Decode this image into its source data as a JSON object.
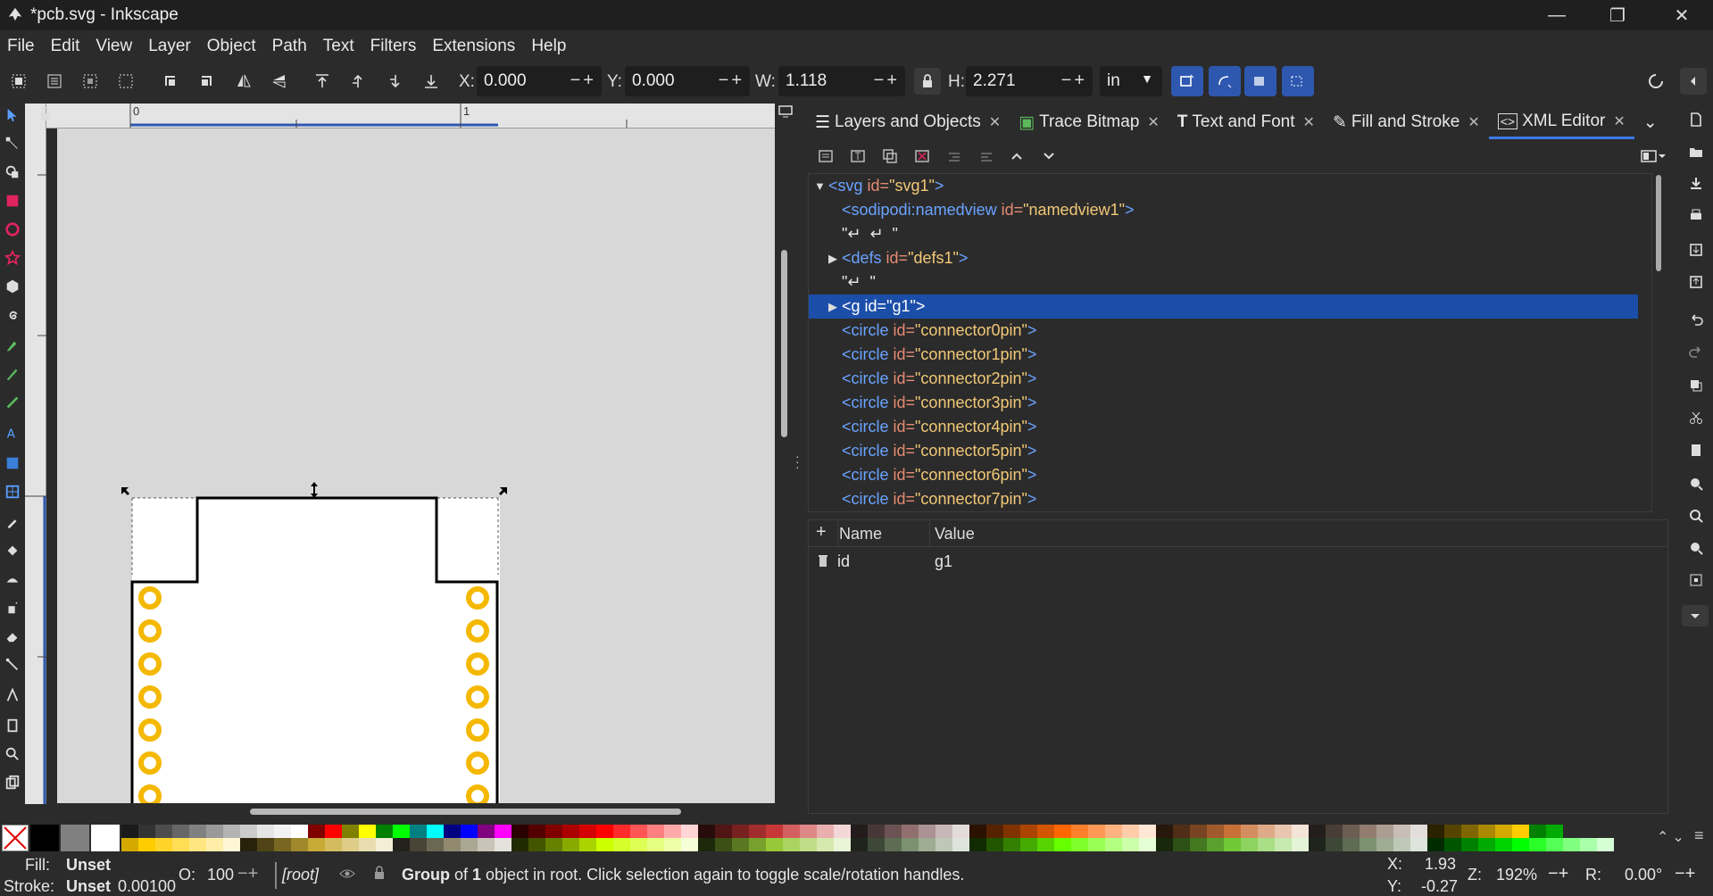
{
  "window": {
    "title": "*pcb.svg - Inkscape",
    "minimize": "—",
    "maximize": "❐",
    "close": "✕"
  },
  "menu": [
    "File",
    "Edit",
    "View",
    "Layer",
    "Object",
    "Path",
    "Text",
    "Filters",
    "Extensions",
    "Help"
  ],
  "toolbar": {
    "x_label": "X:",
    "x_value": "0.000",
    "y_label": "Y:",
    "y_value": "0.000",
    "w_label": "W:",
    "w_value": "1.118",
    "h_label": "H:",
    "h_value": "2.271",
    "unit": "in",
    "spin_buttons": "−+"
  },
  "ruler": {
    "mark0": "0",
    "mark1": "1"
  },
  "tabs": [
    {
      "icon": "layers-icon",
      "label": "Layers and Objects"
    },
    {
      "icon": "trace-bitmap-icon",
      "label": "Trace Bitmap"
    },
    {
      "icon": "text-font-icon",
      "label": "Text and Font"
    },
    {
      "icon": "fill-stroke-icon",
      "label": "Fill and Stroke"
    },
    {
      "icon": "xml-editor-icon",
      "label": "XML Editor"
    }
  ],
  "xml_nodes": [
    {
      "tag": "<svg",
      "attr": " id=",
      "val": "\"svg1\"",
      "close": ">",
      "expander": "▼"
    },
    {
      "tag": "<sodipodi:namedview",
      "attr": " id=",
      "val": "\"namedview1\"",
      "close": ">"
    },
    {
      "text": "\"↵  ↵  \""
    },
    {
      "tag": "<defs",
      "attr": " id=",
      "val": "\"defs1\"",
      "close": ">",
      "expander": "▶"
    },
    {
      "text": "\"↵  \""
    },
    {
      "tag": "<g",
      "attr": " id=",
      "val": "\"g1\"",
      "close": ">",
      "expander": "▶",
      "selected": true
    },
    {
      "tag": "<circle",
      "attr": " id=",
      "val": "\"connector0pin\"",
      "close": ">"
    },
    {
      "tag": "<circle",
      "attr": " id=",
      "val": "\"connector1pin\"",
      "close": ">"
    },
    {
      "tag": "<circle",
      "attr": " id=",
      "val": "\"connector2pin\"",
      "close": ">"
    },
    {
      "tag": "<circle",
      "attr": " id=",
      "val": "\"connector3pin\"",
      "close": ">"
    },
    {
      "tag": "<circle",
      "attr": " id=",
      "val": "\"connector4pin\"",
      "close": ">"
    },
    {
      "tag": "<circle",
      "attr": " id=",
      "val": "\"connector5pin\"",
      "close": ">"
    },
    {
      "tag": "<circle",
      "attr": " id=",
      "val": "\"connector6pin\"",
      "close": ">"
    },
    {
      "tag": "<circle",
      "attr": " id=",
      "val": "\"connector7pin\"",
      "close": ">"
    }
  ],
  "attributes": {
    "add_label": "+",
    "name_header": "Name",
    "value_header": "Value",
    "rows": [
      {
        "name": "id",
        "value": "g1"
      }
    ]
  },
  "palette": {
    "row1": [
      "#000000",
      "#808080",
      "#ffffff",
      "#1a1a1a",
      "#333333",
      "#4d4d4d",
      "#666666",
      "#808080",
      "#999999",
      "#b3b3b3",
      "#cccccc",
      "#e6e6e6",
      "#f2f2f2",
      "#ffffff",
      "#800000",
      "#ff0000",
      "#808000",
      "#ffff00",
      "#008000",
      "#00ff00",
      "#008080",
      "#00ffff",
      "#000080",
      "#0000ff",
      "#800080",
      "#ff00ff",
      "#2b0000",
      "#550000",
      "#800000",
      "#aa0000",
      "#d40000",
      "#ff0000",
      "#ff2a2a",
      "#ff5555",
      "#ff8080",
      "#ffaaaa",
      "#ffd5d5",
      "#280b0b",
      "#501616",
      "#782121",
      "#a02c2c",
      "#c83737",
      "#d35f5f",
      "#de8787",
      "#e9afaf",
      "#f4d7d7",
      "#241c1c",
      "#483737",
      "#6c5353",
      "#916f6f",
      "#ac9393",
      "#c8b7b7",
      "#e3dbdb",
      "#2b1100",
      "#552200",
      "#803300",
      "#aa4400",
      "#d45500",
      "#ff6600",
      "#ff7f2a",
      "#ff9955",
      "#ffb380",
      "#ffccaa",
      "#ffe6d5",
      "#28170b",
      "#502d16",
      "#784421",
      "#a05a2c",
      "#c87137",
      "#d38d5f",
      "#deaa87",
      "#e9c6af",
      "#f4e3d7",
      "#241f1c",
      "#483e37",
      "#6c5d53",
      "#917c6f",
      "#ac9d93",
      "#c8beb7",
      "#e3dedb",
      "#2b2200",
      "#554400",
      "#806600",
      "#aa8800",
      "#d4aa00",
      "#ffcc00",
      "#008000",
      "#00aa00"
    ],
    "row2": [
      "#d4aa00",
      "#ffcc00",
      "#ffd42a",
      "#ffdd55",
      "#ffe680",
      "#ffeeaa",
      "#fff6d5",
      "#28220b",
      "#504416",
      "#786721",
      "#a0892c",
      "#c8ab37",
      "#d3bc5f",
      "#decd87",
      "#e9ddaf",
      "#f4eed7",
      "#24221c",
      "#484537",
      "#6c6753",
      "#918a6f",
      "#aca793",
      "#c8c4b7",
      "#e3e2db",
      "#222b00",
      "#445500",
      "#668000",
      "#88aa00",
      "#aad400",
      "#ccff00",
      "#d4ff2a",
      "#ddff55",
      "#e5ff80",
      "#eeffaa",
      "#f6ffd5",
      "#1e280b",
      "#3c5016",
      "#5a7821",
      "#78a02c",
      "#96c837",
      "#abd35f",
      "#c0de87",
      "#d5e9af",
      "#eaf4d7",
      "#1f241c",
      "#3e4837",
      "#5d6c53",
      "#7c916f",
      "#9dac93",
      "#bec8b7",
      "#dee3db",
      "#112b00",
      "#225500",
      "#338000",
      "#44aa00",
      "#55d400",
      "#66ff00",
      "#7fff2a",
      "#99ff55",
      "#b3ff80",
      "#ccffaa",
      "#e5ffd5",
      "#17280b",
      "#2d5016",
      "#447821",
      "#5aa02c",
      "#71c837",
      "#8dd35f",
      "#aade87",
      "#c6e9af",
      "#e3f4d7",
      "#1f241c",
      "#3e4837",
      "#5d6c53",
      "#7c916f",
      "#9dac93",
      "#bec8b7",
      "#dee3db",
      "#002b00",
      "#005500",
      "#008000",
      "#00aa00",
      "#00d400",
      "#00ff00",
      "#2aff2a",
      "#55ff55",
      "#80ff80",
      "#aaffaa",
      "#d5ffd5"
    ]
  },
  "status": {
    "fill_label": "Fill:",
    "fill_value": "Unset",
    "stroke_label": "Stroke:",
    "stroke_value": "Unset",
    "stroke_width": "0.00100",
    "opacity_label": "O:",
    "opacity_value": "100",
    "layer": "[root]",
    "message_bold": "Group",
    "message_mid": " of ",
    "message_bold2": "1",
    "message_rest": " object in root. Click selection again to toggle scale/rotation handles.",
    "x_label": "X:",
    "x_value": "1.93",
    "y_label": "Y:",
    "y_value": "-0.27",
    "zoom_label": "Z:",
    "zoom_value": "192%",
    "rotation_label": "R:",
    "rotation_value": "0.00°"
  }
}
